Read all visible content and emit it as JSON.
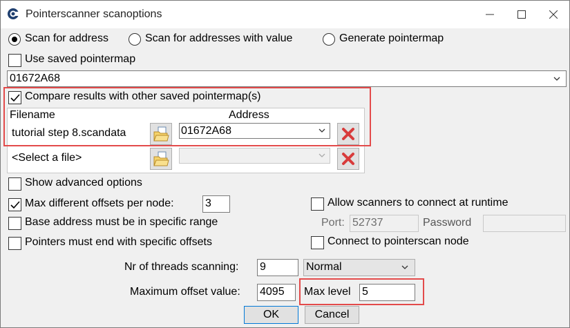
{
  "window": {
    "title": "Pointerscanner scanoptions"
  },
  "scan_mode": {
    "options": [
      {
        "label": "Scan for address",
        "selected": true
      },
      {
        "label": "Scan for addresses with value",
        "selected": false
      },
      {
        "label": "Generate pointermap",
        "selected": false
      }
    ]
  },
  "use_saved_pointermap": {
    "label": "Use saved pointermap",
    "checked": false
  },
  "address_combo": {
    "value": "01672A68"
  },
  "compare": {
    "label": "Compare results with other saved pointermap(s)",
    "checked": true,
    "col_filename": "Filename",
    "col_address": "Address",
    "rows": [
      {
        "filename": "tutorial step 8.scandata",
        "address": "01672A68"
      },
      {
        "filename": "<Select a file>",
        "address": ""
      }
    ]
  },
  "advanced": {
    "label": "Show advanced options",
    "checked": false
  },
  "max_offsets": {
    "label": "Max different offsets per node:",
    "checked": true,
    "value": "3"
  },
  "base_range": {
    "label": "Base address must be in specific range",
    "checked": false
  },
  "end_offsets": {
    "label": "Pointers must end with specific offsets",
    "checked": false
  },
  "allow_scanners": {
    "label": "Allow scanners to connect at runtime",
    "checked": false
  },
  "port": {
    "label": "Port:",
    "value": "52737"
  },
  "password": {
    "label": "Password",
    "value": ""
  },
  "connect_node": {
    "label": "Connect to pointerscan node",
    "checked": false
  },
  "threads": {
    "label": "Nr of threads scanning:",
    "value": "9",
    "priority": "Normal"
  },
  "max_offset_value": {
    "label": "Maximum offset value:",
    "value": "4095"
  },
  "max_level": {
    "label": "Max level",
    "value": "5"
  },
  "buttons": {
    "ok": "OK",
    "cancel": "Cancel"
  },
  "colors": {
    "highlight": "#e34a4a",
    "accent": "#0078d7",
    "delete_icon": "#d83b3b"
  }
}
